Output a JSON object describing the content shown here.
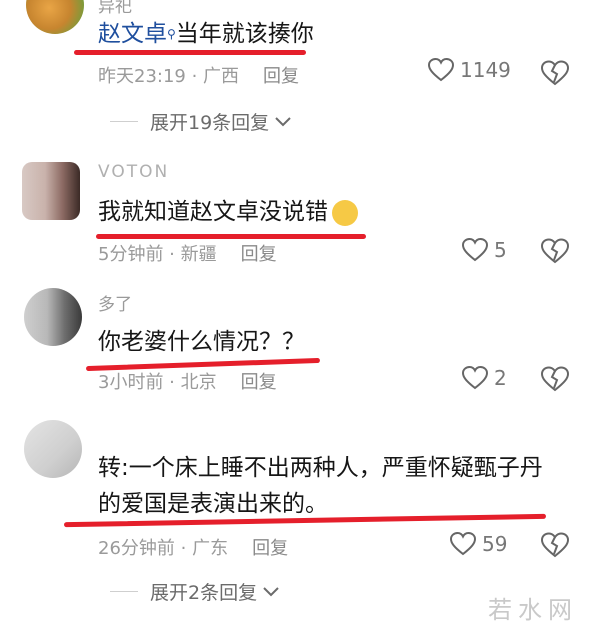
{
  "comments": [
    {
      "username": "异祀",
      "mention": "赵文卓",
      "text": "当年就该揍你",
      "time": "昨天23:19",
      "location": "广西",
      "reply_label": "回复",
      "likes": "1149"
    },
    {
      "username": "VOTON",
      "text": "我就知道赵文卓没说错",
      "time": "5分钟前",
      "location": "新疆",
      "reply_label": "回复",
      "likes": "5"
    },
    {
      "username": "多了",
      "text": "你老婆什么情况？？",
      "time": "3小时前",
      "location": "北京",
      "reply_label": "回复",
      "likes": "2"
    },
    {
      "username": "",
      "text_line1": "转:一个床上睡不出两种人，严重怀疑甄子丹",
      "text_line2": "的爱国是表演出来的。",
      "time": "26分钟前",
      "location": "广东",
      "reply_label": "回复",
      "likes": "59"
    }
  ],
  "expand_1": "展开19条回复",
  "expand_2": "展开2条回复",
  "watermark": "若水网",
  "colors": {
    "highlight_underline": "#e51f2b",
    "mention": "#1f4f9e",
    "meta": "#9a9a9a"
  }
}
